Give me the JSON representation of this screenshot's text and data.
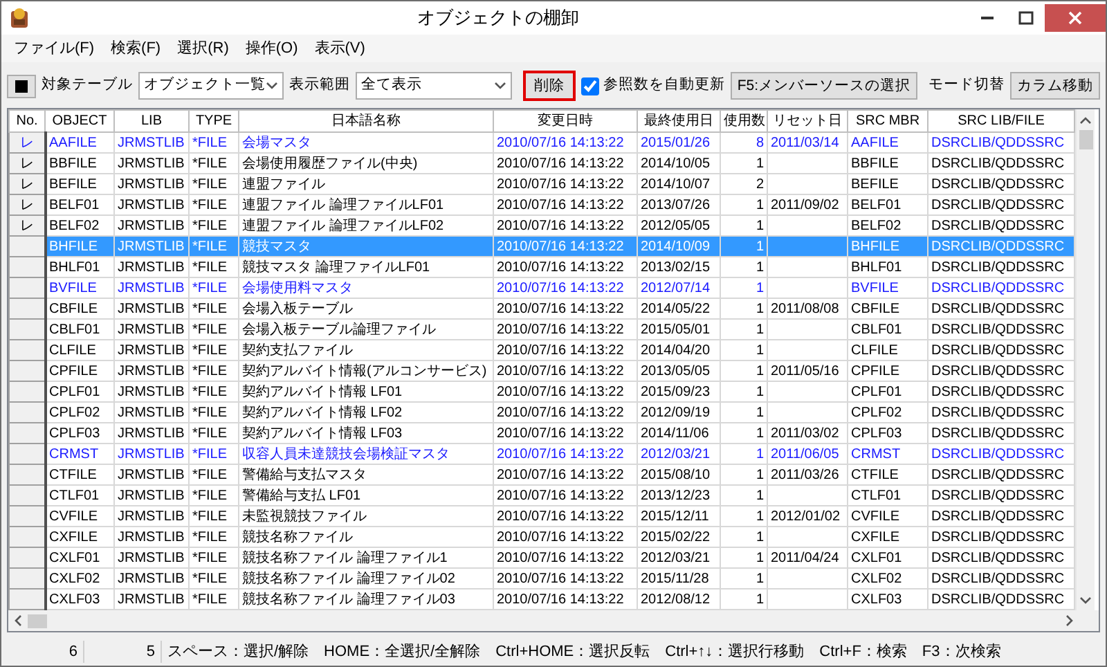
{
  "window": {
    "title": "オブジェクトの棚卸"
  },
  "menu": [
    "ファイル(F)",
    "検索(F)",
    "選択(R)",
    "操作(O)",
    "表示(V)"
  ],
  "toolbar": {
    "target_label": "対象テーブル",
    "target_value": "オブジェクト一覧",
    "range_label": "表示範囲",
    "range_value": "全て表示",
    "delete_button": {
      "label": "削除",
      "focused": true
    },
    "auto_update": {
      "label": "参照数を自動更新",
      "checked": true
    },
    "source_button": "F5:メンバーソースの選択",
    "mode_label": "モード切替",
    "column_move_button": "カラム移動"
  },
  "table": {
    "columns": [
      "No.",
      "OBJECT",
      "LIB",
      "TYPE",
      "日本語名称",
      "変更日時",
      "最終使用日",
      "使用数",
      "リセット日",
      "SRC MBR",
      "SRC LIB/FILE"
    ],
    "rows": [
      {
        "mark": "レ",
        "object": "AAFILE",
        "lib": "JRMSTLIB",
        "type": "*FILE",
        "name_ja": "会場マスタ",
        "modified": "2010/07/16 14:13:22",
        "last_used": "2015/01/26",
        "use_count": "8",
        "reset_date": "2011/03/14",
        "src_mbr": "AAFILE",
        "src_lib_file": "DSRCLIB/QDDSSRC",
        "highlighted": true,
        "selected": false
      },
      {
        "mark": "レ",
        "object": "BBFILE",
        "lib": "JRMSTLIB",
        "type": "*FILE",
        "name_ja": "会場使用履歴ファイル(中央)",
        "modified": "2010/07/16 14:13:22",
        "last_used": "2014/10/05",
        "use_count": "1",
        "src_mbr": "BBFILE",
        "src_lib_file": "DSRCLIB/QDDSSRC",
        "highlighted": false,
        "selected": false
      },
      {
        "mark": "レ",
        "object": "BEFILE",
        "lib": "JRMSTLIB",
        "type": "*FILE",
        "name_ja": "連盟ファイル",
        "modified": "2010/07/16 14:13:22",
        "last_used": "2014/10/07",
        "use_count": "2",
        "src_mbr": "BEFILE",
        "src_lib_file": "DSRCLIB/QDDSSRC",
        "highlighted": false,
        "selected": false
      },
      {
        "mark": "レ",
        "object": "BELF01",
        "lib": "JRMSTLIB",
        "type": "*FILE",
        "name_ja": "連盟ファイル 論理ファイルLF01",
        "modified": "2010/07/16 14:13:22",
        "last_used": "2013/07/26",
        "use_count": "1",
        "reset_date": "2011/09/02",
        "src_mbr": "BELF01",
        "src_lib_file": "DSRCLIB/QDDSSRC",
        "highlighted": false,
        "selected": false
      },
      {
        "mark": "レ",
        "object": "BELF02",
        "lib": "JRMSTLIB",
        "type": "*FILE",
        "name_ja": "連盟ファイル 論理ファイルLF02",
        "modified": "2010/07/16 14:13:22",
        "last_used": "2012/05/05",
        "use_count": "1",
        "src_mbr": "BELF02",
        "src_lib_file": "DSRCLIB/QDDSSRC",
        "highlighted": false,
        "selected": false
      },
      {
        "object": "BHFILE",
        "lib": "JRMSTLIB",
        "type": "*FILE",
        "name_ja": "競技マスタ",
        "modified": "2010/07/16 14:13:22",
        "last_used": "2014/10/09",
        "use_count": "1",
        "src_mbr": "BHFILE",
        "src_lib_file": "DSRCLIB/QDDSSRC",
        "highlighted": false,
        "selected": true
      },
      {
        "object": "BHLF01",
        "lib": "JRMSTLIB",
        "type": "*FILE",
        "name_ja": "競技マスタ 論理ファイルLF01",
        "modified": "2010/07/16 14:13:22",
        "last_used": "2013/02/15",
        "use_count": "1",
        "src_mbr": "BHLF01",
        "src_lib_file": "DSRCLIB/QDDSSRC",
        "highlighted": false,
        "selected": false
      },
      {
        "object": "BVFILE",
        "lib": "JRMSTLIB",
        "type": "*FILE",
        "name_ja": "会場使用料マスタ",
        "modified": "2010/07/16 14:13:22",
        "last_used": "2012/07/14",
        "use_count": "1",
        "src_mbr": "BVFILE",
        "src_lib_file": "DSRCLIB/QDDSSRC",
        "highlighted": true,
        "selected": false
      },
      {
        "object": "CBFILE",
        "lib": "JRMSTLIB",
        "type": "*FILE",
        "name_ja": "会場入板テーブル",
        "modified": "2010/07/16 14:13:22",
        "last_used": "2014/05/22",
        "use_count": "1",
        "reset_date": "2011/08/08",
        "src_mbr": "CBFILE",
        "src_lib_file": "DSRCLIB/QDDSSRC",
        "highlighted": false,
        "selected": false
      },
      {
        "object": "CBLF01",
        "lib": "JRMSTLIB",
        "type": "*FILE",
        "name_ja": "会場入板テーブル論理ファイル",
        "modified": "2010/07/16 14:13:22",
        "last_used": "2015/05/01",
        "use_count": "1",
        "src_mbr": "CBLF01",
        "src_lib_file": "DSRCLIB/QDDSSRC",
        "highlighted": false,
        "selected": false
      },
      {
        "object": "CLFILE",
        "lib": "JRMSTLIB",
        "type": "*FILE",
        "name_ja": "契約支払ファイル",
        "modified": "2010/07/16 14:13:22",
        "last_used": "2014/04/20",
        "use_count": "1",
        "src_mbr": "CLFILE",
        "src_lib_file": "DSRCLIB/QDDSSRC",
        "highlighted": false,
        "selected": false
      },
      {
        "object": "CPFILE",
        "lib": "JRMSTLIB",
        "type": "*FILE",
        "name_ja": "契約アルバイト情報(アルコンサービス)",
        "modified": "2010/07/16 14:13:22",
        "last_used": "2013/05/05",
        "use_count": "1",
        "reset_date": "2011/05/16",
        "src_mbr": "CPFILE",
        "src_lib_file": "DSRCLIB/QDDSSRC",
        "highlighted": false,
        "selected": false
      },
      {
        "object": "CPLF01",
        "lib": "JRMSTLIB",
        "type": "*FILE",
        "name_ja": "契約アルバイト情報 LF01",
        "modified": "2010/07/16 14:13:22",
        "last_used": "2015/09/23",
        "use_count": "1",
        "src_mbr": "CPLF01",
        "src_lib_file": "DSRCLIB/QDDSSRC",
        "highlighted": false,
        "selected": false
      },
      {
        "object": "CPLF02",
        "lib": "JRMSTLIB",
        "type": "*FILE",
        "name_ja": "契約アルバイト情報 LF02",
        "modified": "2010/07/16 14:13:22",
        "last_used": "2012/09/19",
        "use_count": "1",
        "src_mbr": "CPLF02",
        "src_lib_file": "DSRCLIB/QDDSSRC",
        "highlighted": false,
        "selected": false
      },
      {
        "object": "CPLF03",
        "lib": "JRMSTLIB",
        "type": "*FILE",
        "name_ja": "契約アルバイト情報 LF03",
        "modified": "2010/07/16 14:13:22",
        "last_used": "2014/11/06",
        "use_count": "1",
        "reset_date": "2011/03/02",
        "src_mbr": "CPLF03",
        "src_lib_file": "DSRCLIB/QDDSSRC",
        "highlighted": false,
        "selected": false
      },
      {
        "object": "CRMST",
        "lib": "JRMSTLIB",
        "type": "*FILE",
        "name_ja": "収容人員未達競技会場検証マスタ",
        "modified": "2010/07/16 14:13:22",
        "last_used": "2012/03/21",
        "use_count": "1",
        "reset_date": "2011/06/05",
        "src_mbr": "CRMST",
        "src_lib_file": "DSRCLIB/QDDSSRC",
        "highlighted": true,
        "selected": false
      },
      {
        "object": "CTFILE",
        "lib": "JRMSTLIB",
        "type": "*FILE",
        "name_ja": "警備給与支払マスタ",
        "modified": "2010/07/16 14:13:22",
        "last_used": "2015/08/10",
        "use_count": "1",
        "reset_date": "2011/03/26",
        "src_mbr": "CTFILE",
        "src_lib_file": "DSRCLIB/QDDSSRC",
        "highlighted": false,
        "selected": false
      },
      {
        "object": "CTLF01",
        "lib": "JRMSTLIB",
        "type": "*FILE",
        "name_ja": "警備給与支払 LF01",
        "modified": "2010/07/16 14:13:22",
        "last_used": "2013/12/23",
        "use_count": "1",
        "src_mbr": "CTLF01",
        "src_lib_file": "DSRCLIB/QDDSSRC",
        "highlighted": false,
        "selected": false
      },
      {
        "object": "CVFILE",
        "lib": "JRMSTLIB",
        "type": "*FILE",
        "name_ja": "未監視競技ファイル",
        "modified": "2010/07/16 14:13:22",
        "last_used": "2015/12/11",
        "use_count": "1",
        "reset_date": "2012/01/02",
        "src_mbr": "CVFILE",
        "src_lib_file": "DSRCLIB/QDDSSRC",
        "highlighted": false,
        "selected": false
      },
      {
        "object": "CXFILE",
        "lib": "JRMSTLIB",
        "type": "*FILE",
        "name_ja": "競技名称ファイル",
        "modified": "2010/07/16 14:13:22",
        "last_used": "2015/02/22",
        "use_count": "1",
        "src_mbr": "CXFILE",
        "src_lib_file": "DSRCLIB/QDDSSRC",
        "highlighted": false,
        "selected": false
      },
      {
        "object": "CXLF01",
        "lib": "JRMSTLIB",
        "type": "*FILE",
        "name_ja": "競技名称ファイル 論理ファイル1",
        "modified": "2010/07/16 14:13:22",
        "last_used": "2012/03/21",
        "use_count": "1",
        "reset_date": "2011/04/24",
        "src_mbr": "CXLF01",
        "src_lib_file": "DSRCLIB/QDDSSRC",
        "highlighted": false,
        "selected": false
      },
      {
        "object": "CXLF02",
        "lib": "JRMSTLIB",
        "type": "*FILE",
        "name_ja": "競技名称ファイル 論理ファイル02",
        "modified": "2010/07/16 14:13:22",
        "last_used": "2015/11/28",
        "use_count": "1",
        "src_mbr": "CXLF02",
        "src_lib_file": "DSRCLIB/QDDSSRC",
        "highlighted": false,
        "selected": false
      },
      {
        "object": "CXLF03",
        "lib": "JRMSTLIB",
        "type": "*FILE",
        "name_ja": "競技名称ファイル 論理ファイル03",
        "modified": "2010/07/16 14:13:22",
        "last_used": "2012/08/12",
        "use_count": "1",
        "src_mbr": "CXLF03",
        "src_lib_file": "DSRCLIB/QDDSSRC",
        "highlighted": false,
        "selected": false
      }
    ]
  },
  "status_bar": {
    "count_1": "6",
    "count_2": "5",
    "hint": "スペース：選択/解除　HOME：全選択/全解除　Ctrl+HOME：選択反転　Ctrl+↑↓：選択行移動　Ctrl+F：検索　F3：次検索"
  }
}
